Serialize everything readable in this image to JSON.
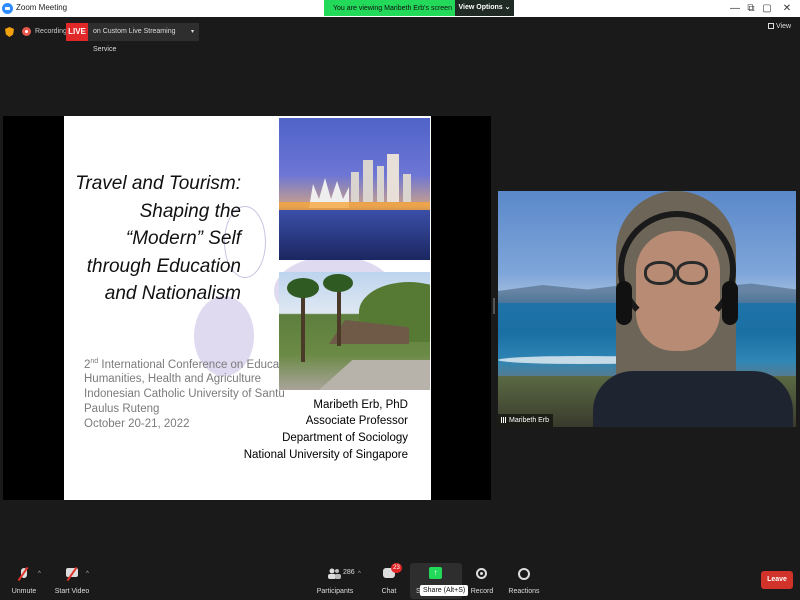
{
  "window": {
    "title": "Zoom Meeting",
    "controls": [
      "—",
      "⧉",
      "▢",
      "✕"
    ]
  },
  "share_banner": {
    "message": "You are viewing Maribeth Erb's screen",
    "view_options": "View Options ⌄"
  },
  "recording": {
    "label": "Recording",
    "live": "LIVE",
    "stream_service": "on Custom Live Streaming Service",
    "caret": "▾"
  },
  "view_button": {
    "label": "View"
  },
  "slide": {
    "title_lines": [
      "Travel and Tourism:",
      "Shaping the",
      "“Modern” Self",
      "through Education",
      "and Nationalism"
    ],
    "conference": {
      "ordinal_num": "2",
      "ordinal_sup": "nd",
      "line1_rest": " International Conference on Education,",
      "line2": "Humanities, Health and Agriculture",
      "line3": "Indonesian Catholic University of Santu",
      "line4": "Paulus Ruteng",
      "line5": "October 20-21, 2022"
    },
    "author_lines": [
      "Maribeth Erb, PhD",
      "Associate Professor",
      "Department of Sociology",
      "National University of Singapore"
    ]
  },
  "participant": {
    "name": "Maribeth Erb"
  },
  "toolbar": {
    "unmute": "Unmute",
    "start_video": "Start Video",
    "participants": "Participants",
    "participant_count": "286",
    "chat": "Chat",
    "chat_badge": "23",
    "share": "S",
    "share_tooltip": "Share (Alt+S)",
    "record": "Record",
    "reactions": "Reactions",
    "leave": "Leave",
    "caret": "^"
  },
  "colors": {
    "banner_green": "#23d959",
    "live_red": "#e02828",
    "leave_red": "#d1332a",
    "background": "#1a1a1a"
  }
}
